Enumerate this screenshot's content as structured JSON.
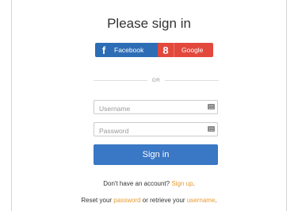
{
  "title": "Please sign in",
  "social": {
    "facebook": {
      "icon": "f",
      "label": "Facebook",
      "color": "#2d6db5"
    },
    "google": {
      "icon": "8",
      "label": "Google",
      "color": "#e2483c"
    }
  },
  "divider": "OR",
  "fields": {
    "username_placeholder": "Username",
    "password_placeholder": "Password"
  },
  "signin_label": "Sign in",
  "signup": {
    "prefix": "Don't have an account?",
    "link": "Sign up",
    "suffix": "."
  },
  "reset": {
    "prefix": "Reset your",
    "password_link": "password",
    "middle": "or retrieve your",
    "username_link": "username",
    "suffix": "."
  },
  "colors": {
    "primary": "#3a77c4",
    "link": "#e99a2c"
  }
}
